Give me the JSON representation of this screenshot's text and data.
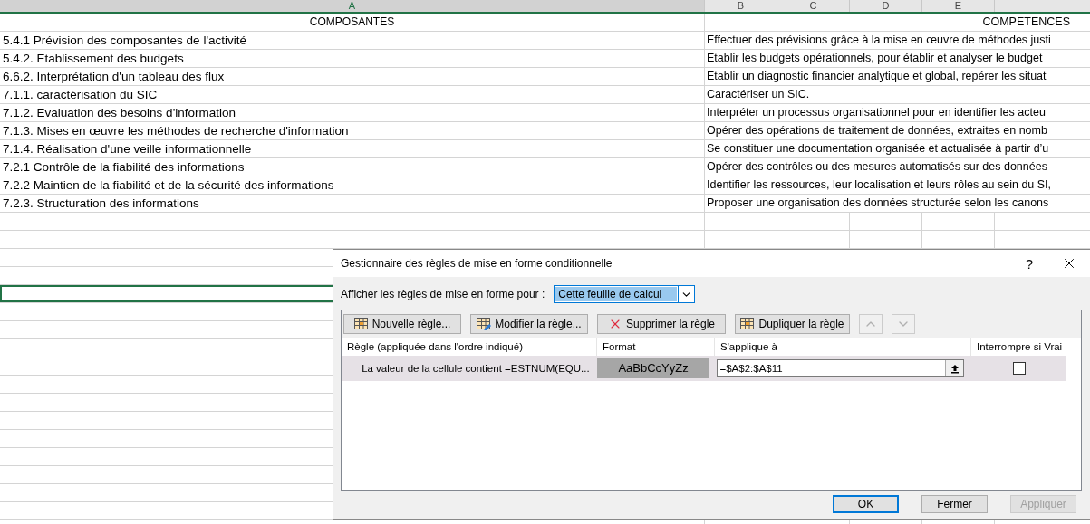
{
  "sheet": {
    "columns": [
      {
        "label": "A",
        "selected": true
      },
      {
        "label": "B",
        "selected": false
      },
      {
        "label": "C",
        "selected": false
      },
      {
        "label": "D",
        "selected": false
      },
      {
        "label": "E",
        "selected": false
      }
    ],
    "header": {
      "column_a": "COMPOSANTES",
      "column_b": "COMPETENCES"
    },
    "rows": [
      {
        "column_a": "5.4.1 Prévision des composantes de l'activité",
        "column_b": "Effectuer des prévisions grâce à la mise en œuvre de méthodes justi"
      },
      {
        "column_a": "5.4.2. Etablissement des budgets",
        "column_b": "Etablir les budgets opérationnels, pour établir et analyser le budget"
      },
      {
        "column_a": "6.6.2. Interprétation d'un tableau des flux",
        "column_b": "Etablir un diagnostic financier analytique et global, repérer les situat"
      },
      {
        "column_a": "7.1.1. caractérisation du SIC",
        "column_b": "Caractériser un SIC."
      },
      {
        "column_a": "7.1.2. Evaluation des besoins d'information",
        "column_b": "Interpréter un processus organisationnel pour en identifier les acteu"
      },
      {
        "column_a": "7.1.3. Mises en œuvre les méthodes de recherche d'information",
        "column_b": "Opérer des opérations de traitement de données, extraites en nomb"
      },
      {
        "column_a": "7.1.4. Réalisation d'une veille informationnelle",
        "column_b": "Se constituer une documentation organisée et actualisée à partir d’u"
      },
      {
        "column_a": "7.2.1 Contrôle de la fiabilité des informations",
        "column_b": "Opérer des contrôles ou des mesures automatisés sur des données"
      },
      {
        "column_a": "7.2.2 Maintien de la fiabilité et de la sécurité des informations",
        "column_b": "Identifier les ressources, leur localisation et leurs rôles au sein du SI,"
      },
      {
        "column_a": "7.2.3. Structuration des informations",
        "column_b": "Proposer une organisation des données structurée selon les canons"
      }
    ],
    "empty_rows": [
      {
        "selected": false
      },
      {
        "selected": false
      },
      {
        "selected": false
      },
      {
        "selected": false
      },
      {
        "selected": true
      },
      {
        "selected": false
      },
      {
        "selected": false
      },
      {
        "selected": false
      },
      {
        "selected": false
      },
      {
        "selected": false
      },
      {
        "selected": false
      },
      {
        "selected": false
      },
      {
        "selected": false
      },
      {
        "selected": false
      },
      {
        "selected": false
      },
      {
        "selected": false
      },
      {
        "selected": false
      },
      {
        "selected": false
      }
    ]
  },
  "dialog": {
    "title": "Gestionnaire des règles de mise en forme conditionnelle",
    "help": "?",
    "scope_label": "Afficher les règles de mise en forme pour :",
    "scope_value": "Cette feuille de calcul",
    "toolbar": [
      {
        "kind": "new",
        "label": "Nouvelle règle...",
        "disabled": false
      },
      {
        "kind": "edit",
        "label": "Modifier la règle...",
        "disabled": false
      },
      {
        "kind": "delete",
        "label": "Supprimer la règle",
        "disabled": false
      },
      {
        "kind": "duplicate",
        "label": "Dupliquer la règle",
        "disabled": false
      },
      {
        "kind": "up",
        "disabled": true
      },
      {
        "kind": "down",
        "disabled": true
      }
    ],
    "table": {
      "columns": [
        "Règle (appliquée dans l'ordre indiqué)",
        "Format",
        "S'applique à",
        "Interrompre si Vrai"
      ],
      "rows": [
        {
          "rule": "La valeur de la cellule contient =ESTNUM(EQU...",
          "format": "AaBbCcYyZz",
          "applies_to": "=$A$2:$A$11",
          "stop_if_true": false,
          "selected": true
        }
      ]
    },
    "buttons": [
      {
        "label": "OK",
        "default": true,
        "disabled": false
      },
      {
        "label": "Fermer",
        "default": false,
        "disabled": false
      },
      {
        "label": "Appliquer",
        "default": false,
        "disabled": true
      }
    ]
  }
}
